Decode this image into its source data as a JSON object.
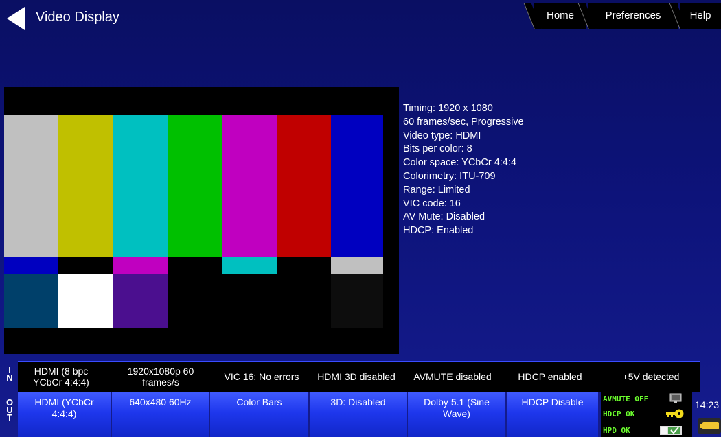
{
  "header": {
    "title": "Video Display",
    "nav": [
      {
        "key": "home",
        "label": "Home"
      },
      {
        "key": "preferences",
        "label": "Preferences"
      },
      {
        "key": "help",
        "label": "Help"
      }
    ]
  },
  "test_pattern": {
    "name": "Color Bars",
    "top_bar_colors": [
      "#c0c0c0",
      "#c0c000",
      "#00c0c0",
      "#00c000",
      "#c000c0",
      "#c00000",
      "#0000c0"
    ],
    "middle_bar_colors": [
      "#0000c0",
      "#000000",
      "#c000c0",
      "#000000",
      "#00c0c0",
      "#000000",
      "#c0c0c0"
    ],
    "bottom_bar_colors": [
      "#00406a",
      "#ffffff",
      "#4b0f8f",
      "#000000",
      "#000000",
      "#000000",
      "#0d0d0d"
    ]
  },
  "video_info": [
    "Timing: 1920 x 1080",
    "60 frames/sec, Progressive",
    "Video type: HDMI",
    "Bits per color: 8",
    "Color space: YCbCr 4:4:4",
    "Colorimetry: ITU-709",
    "Range: Limited",
    "VIC code: 16",
    "AV Mute: Disabled",
    "HDCP: Enabled"
  ],
  "in_status": {
    "label": "IN",
    "cells": [
      "HDMI (8 bpc\nYCbCr 4:4:4)",
      "1920x1080p 60\nframes/s",
      "VIC 16: No errors",
      "HDMI 3D disabled",
      "AVMUTE disabled",
      "HDCP enabled",
      "+5V detected"
    ]
  },
  "out_status": {
    "label": "OUT",
    "buttons": [
      "HDMI (YCbCr\n4:4:4)",
      "640x480 60Hz",
      "Color Bars",
      "3D: Disabled",
      "Dolby 5.1 (Sine\nWave)",
      "HDCP Disable"
    ]
  },
  "status_indicators": {
    "avmute": "AVMUTE OFF",
    "hdcp": "HDCP OK",
    "hpd": "HPD OK",
    "icons": [
      "monitor-icon",
      "key-icon",
      "check-switch-icon"
    ]
  },
  "system": {
    "clock": "14:23",
    "battery_icon": "battery-icon"
  },
  "colors": {
    "background": "#0d137a",
    "status_green": "#6cff2e",
    "button_blue": "#1e37ec"
  }
}
